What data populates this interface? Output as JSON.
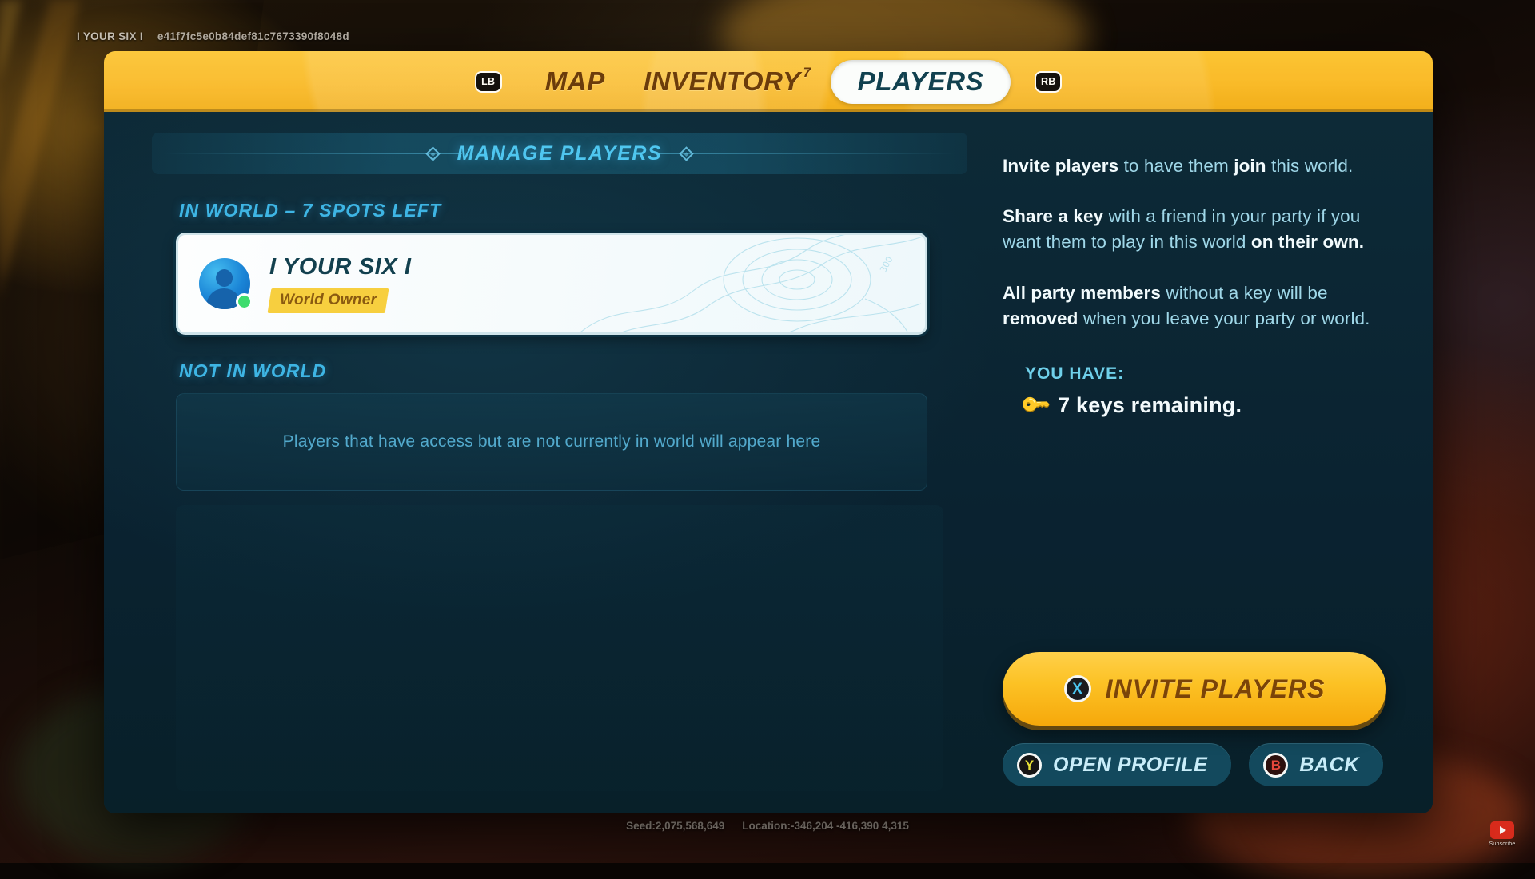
{
  "overlay": {
    "gamertag": "I YOUR SIX I",
    "hash": "e41f7fc5e0b84def81c7673390f8048d"
  },
  "hud": {
    "seed": "Seed:2,075,568,649",
    "location": "Location:-346,204  -416,390  4,315"
  },
  "watermark": {
    "label": "Subscribe",
    "icon": "youtube-play-icon"
  },
  "tabbar": {
    "left_bumper": "LB",
    "right_bumper": "RB",
    "tabs": [
      {
        "label": "MAP",
        "badge": "",
        "active": false
      },
      {
        "label": "INVENTORY",
        "badge": "7",
        "active": false
      },
      {
        "label": "PLAYERS",
        "badge": "",
        "active": true
      }
    ]
  },
  "main": {
    "header_title": "MANAGE PLAYERS",
    "in_world_label": "IN WORLD – 7 SPOTS LEFT",
    "not_in_world_label": "NOT IN WORLD",
    "not_in_world_empty": "Players that have access but are not currently in world will appear here",
    "players": [
      {
        "name": "I YOUR SIX I",
        "role": "World Owner",
        "status": "online"
      }
    ]
  },
  "sidebar": {
    "paragraphs": [
      {
        "id": "p1",
        "parts": [
          {
            "text": "Invite players ",
            "strong": true
          },
          {
            "text": "to have them ",
            "strong": false
          },
          {
            "text": "join ",
            "strong": true
          },
          {
            "text": "this world.",
            "strong": false
          }
        ]
      },
      {
        "id": "p2",
        "parts": [
          {
            "text": "Share a key ",
            "strong": true
          },
          {
            "text": "with a friend in your party if you want them to play in this world ",
            "strong": false
          },
          {
            "text": "on their own.",
            "strong": true
          }
        ]
      },
      {
        "id": "p3",
        "parts": [
          {
            "text": "All party members ",
            "strong": true
          },
          {
            "text": "without a key will be ",
            "strong": false
          },
          {
            "text": "removed ",
            "strong": true
          },
          {
            "text": "when you leave your party or world.",
            "strong": false
          }
        ]
      }
    ],
    "you_have_label": "YOU HAVE:",
    "keys_icon": "key-icon",
    "keys_remaining": "7 keys remaining."
  },
  "actions": {
    "invite": {
      "label": "INVITE PLAYERS",
      "button": "X"
    },
    "open_profile": {
      "label": "OPEN PROFILE",
      "button": "Y"
    },
    "back": {
      "label": "BACK",
      "button": "B"
    }
  },
  "colors": {
    "tab_gold": "#fcc022",
    "panel_teal": "#0c2733",
    "accent_cyan": "#4fc6ef",
    "badge_yellow": "#f7cf3f",
    "online_green": "#3ddc6d"
  }
}
